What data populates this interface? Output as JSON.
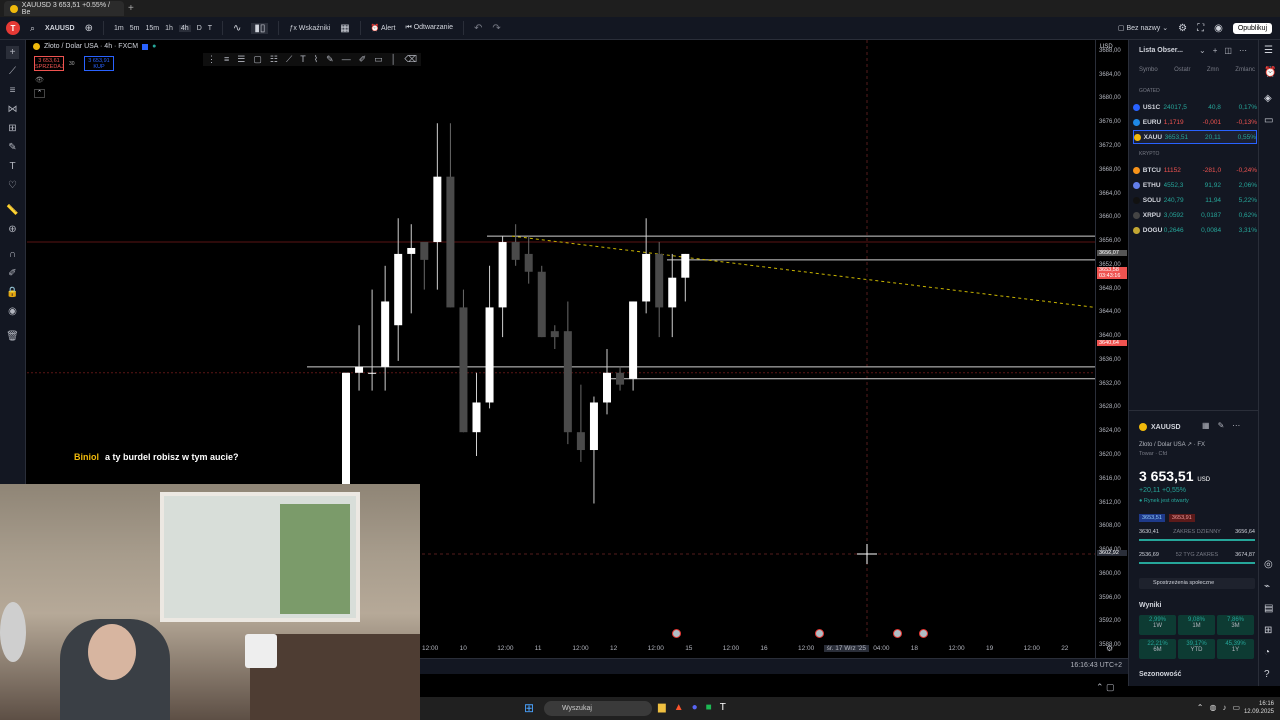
{
  "browser": {
    "tab_title": "XAUUSD 3 653,51 +0.55% / Be",
    "new_tab": "+"
  },
  "toolbar": {
    "logo": "T",
    "symbol": "XAUUSD",
    "intervals": [
      "1m",
      "5m",
      "15m",
      "1h",
      "4h",
      "D",
      "T"
    ],
    "indicators": "Wskaźniki",
    "alert": "Alert",
    "replay": "Odtwarzanie",
    "layout_name": "Bez nazwy",
    "publish": "Opublikuj"
  },
  "legend": {
    "title": "Złoto / Dolar USA · 4h · FXCM",
    "sell_price": "3 653,61",
    "sell_label": "SPRZEDAJ",
    "buy_price": "3 653,91",
    "buy_label": "KUP",
    "spread": "30"
  },
  "price_axis": {
    "currency": "USD",
    "ticks": [
      "3688,00",
      "3684,00",
      "3680,00",
      "3676,00",
      "3672,00",
      "3668,00",
      "3664,00",
      "3660,00",
      "3656,00",
      "3652,00",
      "3648,00",
      "3644,00",
      "3640,00",
      "3636,00",
      "3632,00",
      "3628,00",
      "3624,00",
      "3620,00",
      "3616,00",
      "3612,00",
      "3608,00",
      "3604,00",
      "3600,00",
      "3596,00",
      "3592,00",
      "3588,00"
    ],
    "marker_top": "3656,07",
    "marker_current": "3653,58",
    "marker_timer": "03:43:16",
    "marker_red": "3640,64",
    "crosshair": "3602,92"
  },
  "time_axis": {
    "labels": [
      "12:00",
      "10",
      "12:00",
      "11",
      "12:00",
      "12",
      "12:00",
      "15",
      "12:00",
      "16",
      "12:00",
      "śr. 17 Wrz '25",
      "04:00",
      "18",
      "12:00",
      "19",
      "12:00",
      "22"
    ],
    "clock": "16:16:43 UTC+2"
  },
  "watchlist": {
    "title": "Lista Obser...",
    "columns": [
      "Symbo",
      "Ostatr",
      "Zmn",
      "Zmlanc"
    ],
    "group_goods": "GOATED",
    "group_crypto": "KRYPTO",
    "rows": [
      {
        "sym": "US1C",
        "last": "24017,5",
        "chg": "40,8",
        "pct": "0,17%",
        "pos": true,
        "color": "#2962ff"
      },
      {
        "sym": "EURU",
        "last": "1,1719",
        "chg": "-0,001",
        "pct": "-0,13%",
        "pos": false,
        "color": "#1e88e5"
      },
      {
        "sym": "XAUU",
        "last": "3653,51",
        "chg": "20,11",
        "pct": "0,55%",
        "pos": true,
        "color": "#f0b90b"
      },
      {
        "sym": "BTCU",
        "last": "11152",
        "chg": "-281,0",
        "pct": "-0,24%",
        "pos": false,
        "color": "#f7931a"
      },
      {
        "sym": "ETHU",
        "last": "4552,3",
        "chg": "91,92",
        "pct": "2,06%",
        "pos": true,
        "color": "#627eea"
      },
      {
        "sym": "SOLU",
        "last": "240,79",
        "chg": "11,94",
        "pct": "5,22%",
        "pos": true,
        "color": "#111"
      },
      {
        "sym": "XRPU",
        "last": "3,0592",
        "chg": "0,0187",
        "pct": "0,62%",
        "pos": true,
        "color": "#444"
      },
      {
        "sym": "DOGU",
        "last": "0,2646",
        "chg": "0,0084",
        "pct": "3,31%",
        "pos": true,
        "color": "#c2a633"
      }
    ]
  },
  "details": {
    "symbol": "XAUUSD",
    "name": "Złoto / Dolar USA",
    "exchange": "FX",
    "type": "Towar · Cfd",
    "price": "3 653,51",
    "currency": "USD",
    "change": "+20,11",
    "change_pct": "+0,55%",
    "market_status": "Rynek jest otwarty",
    "bid": "3653,51",
    "ask": "3653,91",
    "day_low": "3630,41",
    "day_range_label": "ZAKRES DZIENNY",
    "day_high": "3656,64",
    "week_low": "2536,69",
    "week_range_label": "52 TYG ZAKRES",
    "week_high": "3674,87",
    "community": "Spostrzeżenia społeczne",
    "results_title": "Wyniki",
    "results": [
      {
        "v": "2,99%",
        "p": "1W"
      },
      {
        "v": "9,08%",
        "p": "1M"
      },
      {
        "v": "7,86%",
        "p": "3M"
      },
      {
        "v": "22,21%",
        "p": "6M"
      },
      {
        "v": "39,17%",
        "p": "YTD"
      },
      {
        "v": "45,39%",
        "p": "1Y"
      }
    ],
    "seasonality": "Sezonowość"
  },
  "chat": {
    "user": "Biniol",
    "message": "a ty burdel robisz w tym aucie?"
  },
  "taskbar": {
    "search": "Wyszukaj",
    "time": "16:16",
    "date": "12.09.2025"
  },
  "chart_data": {
    "type": "candlestick",
    "ylim": [
      3586,
      3690
    ],
    "candles": [
      {
        "o": 3611,
        "h": 3634,
        "l": 3608,
        "c": 3634
      },
      {
        "o": 3634,
        "h": 3642,
        "l": 3631,
        "c": 3635
      },
      {
        "o": 3634,
        "h": 3648,
        "l": 3631,
        "c": 3634
      },
      {
        "o": 3635,
        "h": 3652,
        "l": 3631,
        "c": 3646
      },
      {
        "o": 3642,
        "h": 3660,
        "l": 3636,
        "c": 3654
      },
      {
        "o": 3654,
        "h": 3659,
        "l": 3644,
        "c": 3655
      },
      {
        "o": 3656,
        "h": 3655,
        "l": 3648,
        "c": 3653
      },
      {
        "o": 3656,
        "h": 3676,
        "l": 3648,
        "c": 3667
      },
      {
        "o": 3667,
        "h": 3676,
        "l": 3645,
        "c": 3645
      },
      {
        "o": 3645,
        "h": 3648,
        "l": 3624,
        "c": 3624
      },
      {
        "o": 3624,
        "h": 3634,
        "l": 3620,
        "c": 3629
      },
      {
        "o": 3629,
        "h": 3652,
        "l": 3628,
        "c": 3645
      },
      {
        "o": 3645,
        "h": 3657,
        "l": 3640,
        "c": 3656
      },
      {
        "o": 3656,
        "h": 3659,
        "l": 3652,
        "c": 3653
      },
      {
        "o": 3654,
        "h": 3657,
        "l": 3649,
        "c": 3651
      },
      {
        "o": 3651,
        "h": 3652,
        "l": 3640,
        "c": 3640
      },
      {
        "o": 3641,
        "h": 3642,
        "l": 3638,
        "c": 3640
      },
      {
        "o": 3641,
        "h": 3646,
        "l": 3622,
        "c": 3624
      },
      {
        "o": 3624,
        "h": 3632,
        "l": 3619,
        "c": 3621
      },
      {
        "o": 3621,
        "h": 3630,
        "l": 3612,
        "c": 3629
      },
      {
        "o": 3629,
        "h": 3638,
        "l": 3627,
        "c": 3634
      },
      {
        "o": 3634,
        "h": 3635,
        "l": 3631,
        "c": 3632
      },
      {
        "o": 3633,
        "h": 3646,
        "l": 3631,
        "c": 3646
      },
      {
        "o": 3646,
        "h": 3660,
        "l": 3644,
        "c": 3654
      },
      {
        "o": 3654,
        "h": 3656,
        "l": 3640,
        "c": 3645
      },
      {
        "o": 3645,
        "h": 3654,
        "l": 3640,
        "c": 3650
      },
      {
        "o": 3650,
        "h": 3654,
        "l": 3646,
        "c": 3654
      }
    ]
  }
}
